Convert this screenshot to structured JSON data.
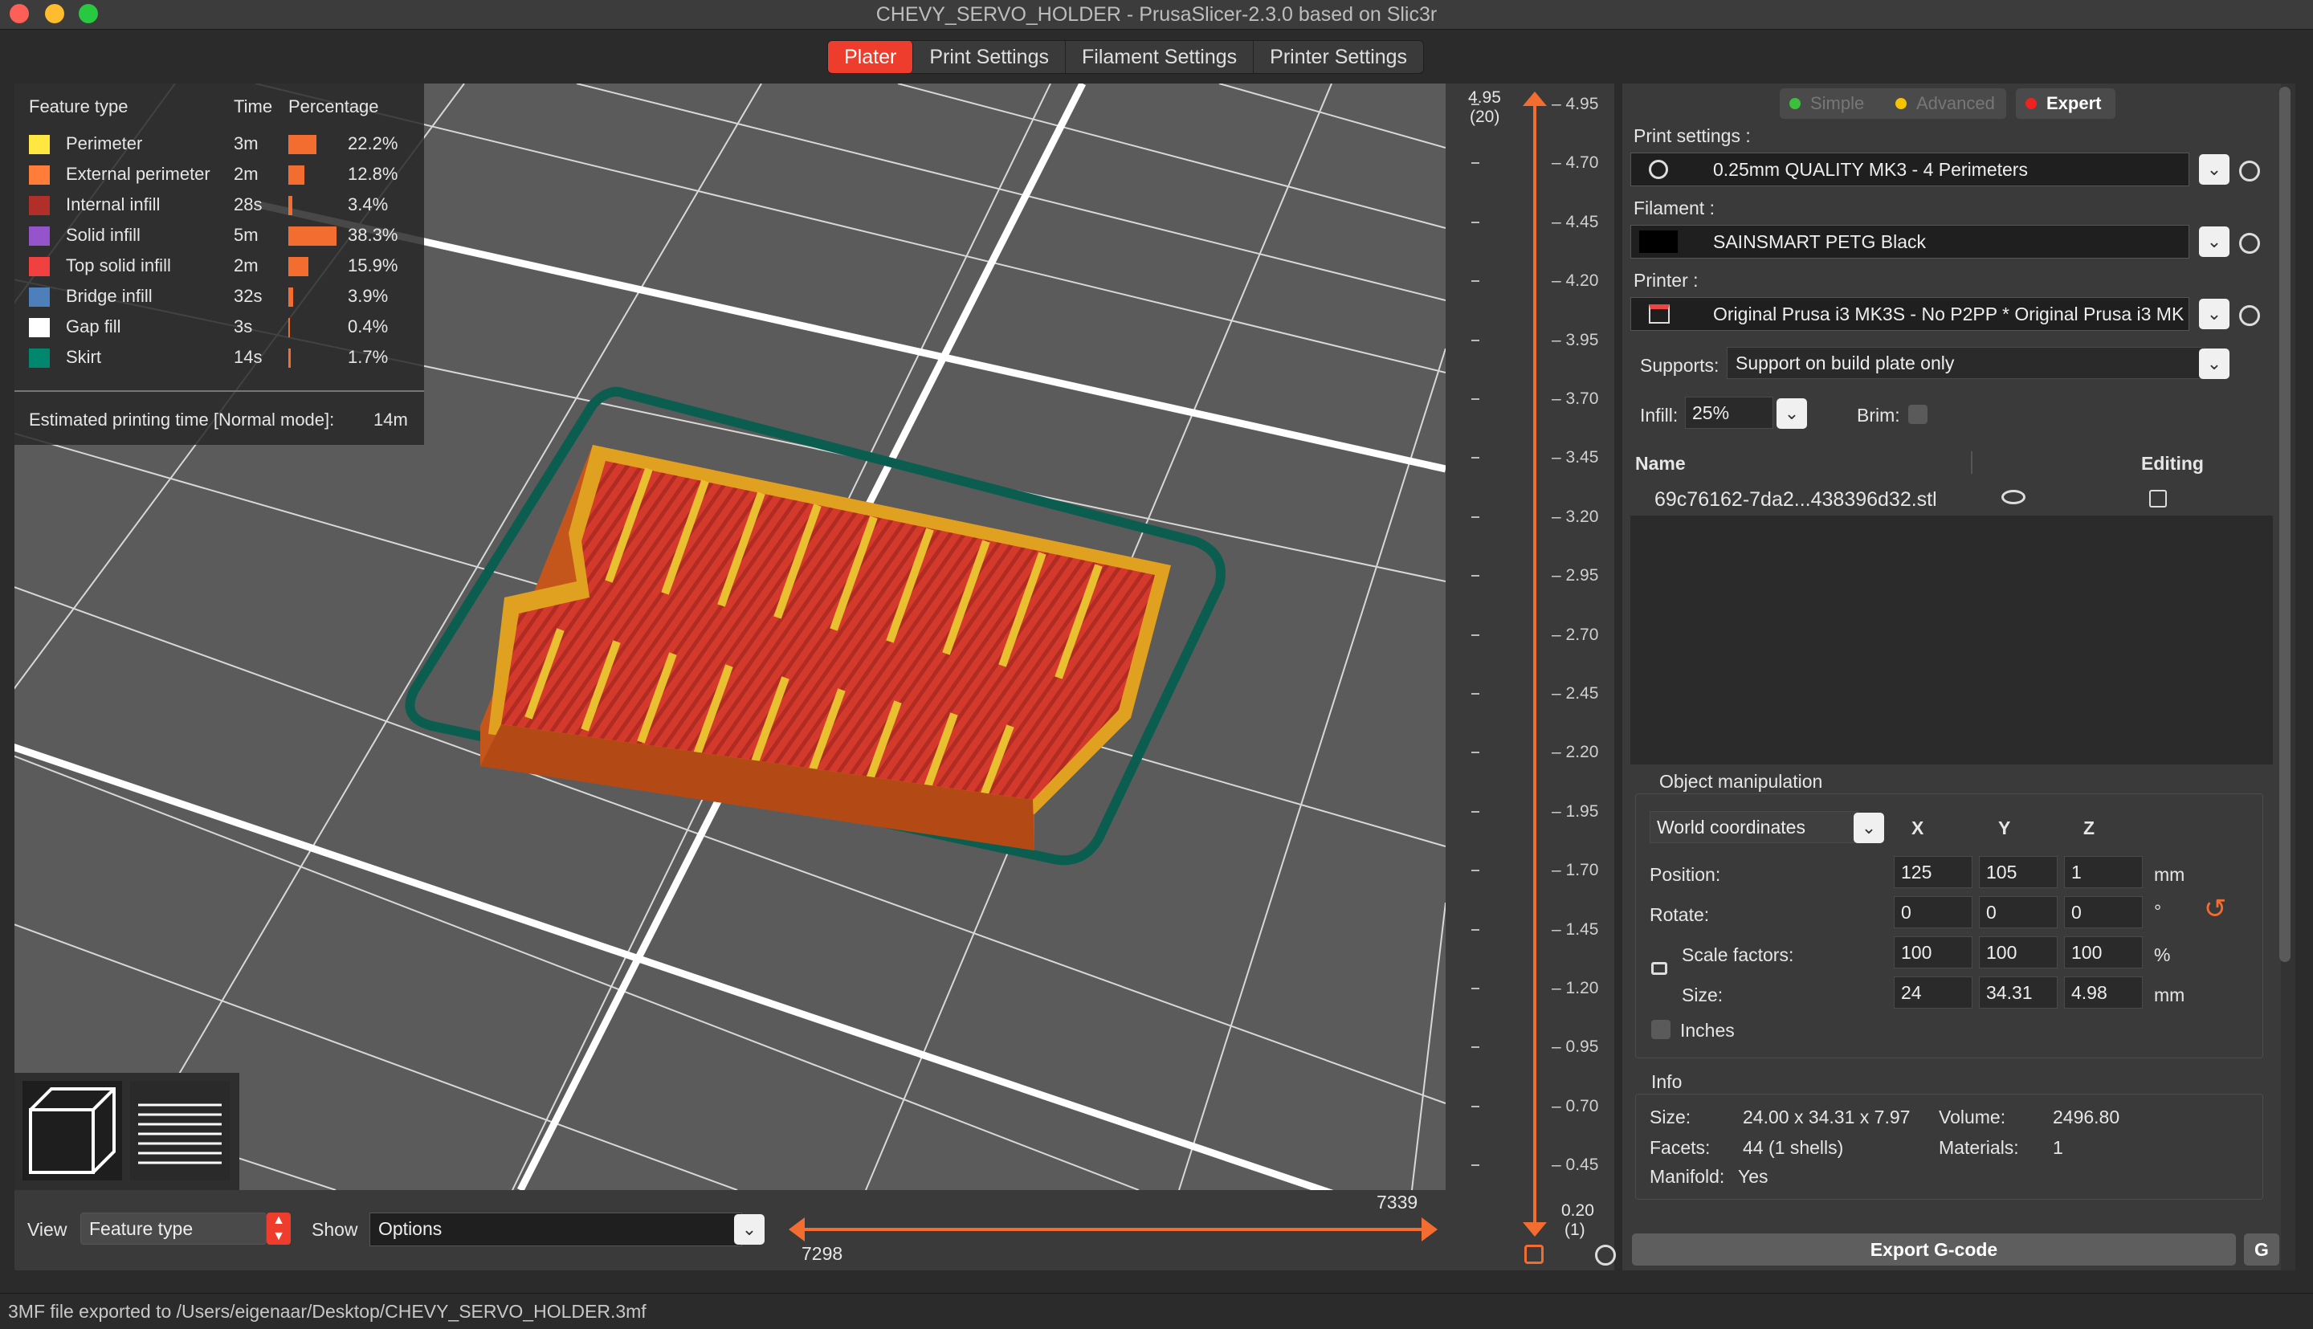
{
  "window": {
    "title": "CHEVY_SERVO_HOLDER - PrusaSlicer-2.3.0 based on Slic3r"
  },
  "tabs": [
    "Plater",
    "Print Settings",
    "Filament Settings",
    "Printer Settings"
  ],
  "legend": {
    "headers": {
      "feature": "Feature type",
      "time": "Time",
      "percentage": "Percentage"
    },
    "rows": [
      {
        "name": "Perimeter",
        "time": "3m",
        "pct": "22.2%",
        "value": 22.2,
        "color": "#ffe640"
      },
      {
        "name": "External perimeter",
        "time": "2m",
        "pct": "12.8%",
        "value": 12.8,
        "color": "#ff7d38"
      },
      {
        "name": "Internal infill",
        "time": "28s",
        "pct": "3.4%",
        "value": 3.4,
        "color": "#b03029"
      },
      {
        "name": "Solid infill",
        "time": "5m",
        "pct": "38.3%",
        "value": 38.3,
        "color": "#9654cc"
      },
      {
        "name": "Top solid infill",
        "time": "2m",
        "pct": "15.9%",
        "value": 15.9,
        "color": "#f04040"
      },
      {
        "name": "Bridge infill",
        "time": "32s",
        "pct": "3.9%",
        "value": 3.9,
        "color": "#4d80ba"
      },
      {
        "name": "Gap fill",
        "time": "3s",
        "pct": "0.4%",
        "value": 0.4,
        "color": "#ffffff"
      },
      {
        "name": "Skirt",
        "time": "14s",
        "pct": "1.7%",
        "value": 1.7,
        "color": "#00876e"
      }
    ],
    "estimated_label": "Estimated printing time [Normal mode]:",
    "estimated_value": "14m"
  },
  "viewbar": {
    "view_label": "View",
    "view_value": "Feature type",
    "show_label": "Show",
    "show_value": "Options",
    "h_slider_top": "7339",
    "h_slider_bottom": "7298"
  },
  "vslider": {
    "top_value": "4.95",
    "top_layer": "(20)",
    "bottom_value": "0.20",
    "bottom_layer": "(1)",
    "ticks": [
      "4.95",
      "4.70",
      "4.45",
      "4.20",
      "3.95",
      "3.70",
      "3.45",
      "3.20",
      "2.95",
      "2.70",
      "2.45",
      "2.20",
      "1.95",
      "1.70",
      "1.45",
      "1.20",
      "0.95",
      "0.70",
      "0.45"
    ]
  },
  "modes": {
    "simple": "Simple",
    "advanced": "Advanced",
    "expert": "Expert"
  },
  "presets": {
    "print_label": "Print settings :",
    "print_value": "0.25mm QUALITY MK3 - 4 Perimeters",
    "filament_label": "Filament :",
    "filament_value": "SAINSMART PETG Black",
    "printer_label": "Printer :",
    "printer_value": "Original Prusa i3 MK3S - No P2PP * Original Prusa i3 MK",
    "supports_label": "Supports:",
    "supports_value": "Support on build plate only",
    "infill_label": "Infill:",
    "infill_value": "25%",
    "brim_label": "Brim:"
  },
  "object_list": {
    "col_name": "Name",
    "col_editing": "Editing",
    "items": [
      {
        "name": "69c76162-7da2...438396d32.stl"
      }
    ]
  },
  "manipulation": {
    "title": "Object manipulation",
    "coords": "World coordinates",
    "axes": [
      "X",
      "Y",
      "Z"
    ],
    "position_label": "Position:",
    "position": [
      "125",
      "105",
      "1"
    ],
    "position_unit": "mm",
    "rotate_label": "Rotate:",
    "rotate": [
      "0",
      "0",
      "0"
    ],
    "rotate_unit": "°",
    "scale_label": "Scale factors:",
    "scale": [
      "100",
      "100",
      "100"
    ],
    "scale_unit": "%",
    "size_label": "Size:",
    "size": [
      "24",
      "34.31",
      "4.98"
    ],
    "size_unit": "mm",
    "inches_label": "Inches"
  },
  "info": {
    "title": "Info",
    "size_label": "Size:",
    "size_value": "24.00 x 34.31 x 7.97",
    "volume_label": "Volume:",
    "volume_value": "2496.80",
    "facets_label": "Facets:",
    "facets_value": "44 (1 shells)",
    "materials_label": "Materials:",
    "materials_value": "1",
    "manifold_label": "Manifold:",
    "manifold_value": "Yes"
  },
  "export_label": "Export G-code",
  "status": "3MF file exported to /Users/eigenaar/Desktop/CHEVY_SERVO_HOLDER.3mf"
}
